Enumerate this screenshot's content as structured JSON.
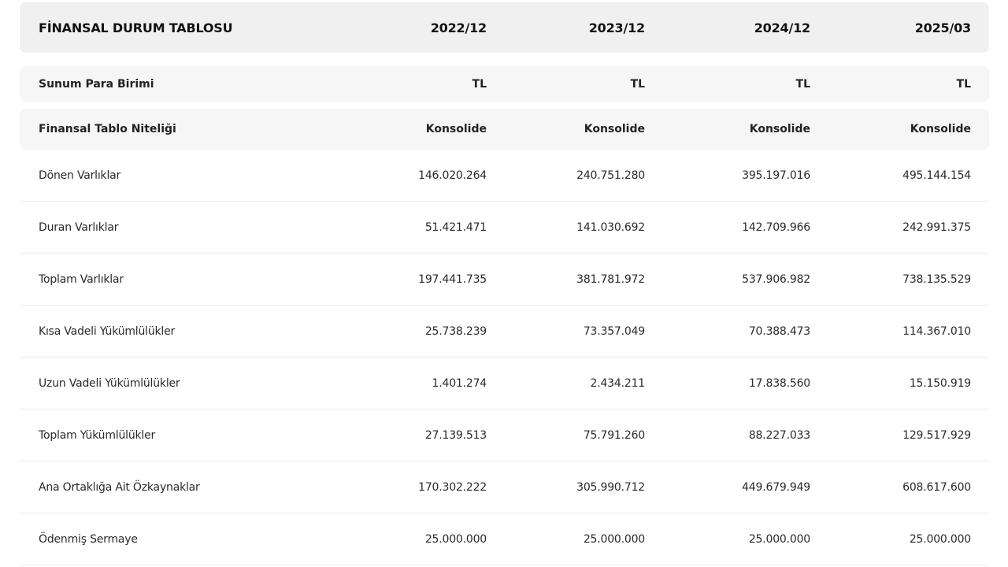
{
  "header": {
    "title": "FİNANSAL DURUM TABLOSU",
    "periods": [
      "2022/12",
      "2023/12",
      "2024/12",
      "2025/03"
    ]
  },
  "currency_row": {
    "label": "Sunum Para Birimi",
    "values": [
      "TL",
      "TL",
      "TL",
      "TL"
    ]
  },
  "nature_row": {
    "label": "Finansal Tablo Niteliği",
    "values": [
      "Konsolide",
      "Konsolide",
      "Konsolide",
      "Konsolide"
    ]
  },
  "rows": [
    {
      "label": "Dönen Varlıklar",
      "values": [
        "146.020.264",
        "240.751.280",
        "395.197.016",
        "495.144.154"
      ]
    },
    {
      "label": "Duran Varlıklar",
      "values": [
        "51.421.471",
        "141.030.692",
        "142.709.966",
        "242.991.375"
      ]
    },
    {
      "label": "Toplam Varlıklar",
      "values": [
        "197.441.735",
        "381.781.972",
        "537.906.982",
        "738.135.529"
      ]
    },
    {
      "label": "Kısa Vadeli Yükümlülükler",
      "values": [
        "25.738.239",
        "73.357.049",
        "70.388.473",
        "114.367.010"
      ]
    },
    {
      "label": "Uzun Vadeli Yükümlülükler",
      "values": [
        "1.401.274",
        "2.434.211",
        "17.838.560",
        "15.150.919"
      ]
    },
    {
      "label": "Toplam Yükümlülükler",
      "values": [
        "27.139.513",
        "75.791.260",
        "88.227.033",
        "129.517.929"
      ]
    },
    {
      "label": "Ana Ortaklığa Ait Özkaynaklar",
      "values": [
        "170.302.222",
        "305.990.712",
        "449.679.949",
        "608.617.600"
      ]
    },
    {
      "label": "Ödenmiş Sermaye",
      "values": [
        "25.000.000",
        "25.000.000",
        "25.000.000",
        "25.000.000"
      ]
    }
  ]
}
